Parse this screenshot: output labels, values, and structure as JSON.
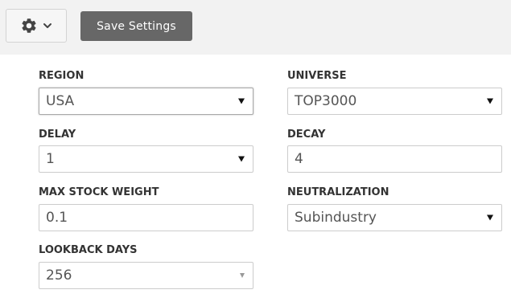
{
  "toolbar": {
    "save_label": "Save Settings"
  },
  "fields": {
    "region": {
      "label": "REGION",
      "value": "USA"
    },
    "universe": {
      "label": "UNIVERSE",
      "value": "TOP3000"
    },
    "delay": {
      "label": "DELAY",
      "value": "1"
    },
    "decay": {
      "label": "DECAY",
      "value": "4"
    },
    "max_stock_weight": {
      "label": "MAX STOCK WEIGHT",
      "value": "0.1"
    },
    "neutralization": {
      "label": "NEUTRALIZATION",
      "value": "Subindustry"
    },
    "lookback_days": {
      "label": "LOOKBACK DAYS",
      "value": "256"
    }
  },
  "icons": {
    "settings": "gear-icon",
    "menu": "chevron-down-icon",
    "dropdown": "dropdown-arrow-icon"
  },
  "colors": {
    "toolbar_bg": "#f2f2f2",
    "save_button_bg": "#676767"
  }
}
